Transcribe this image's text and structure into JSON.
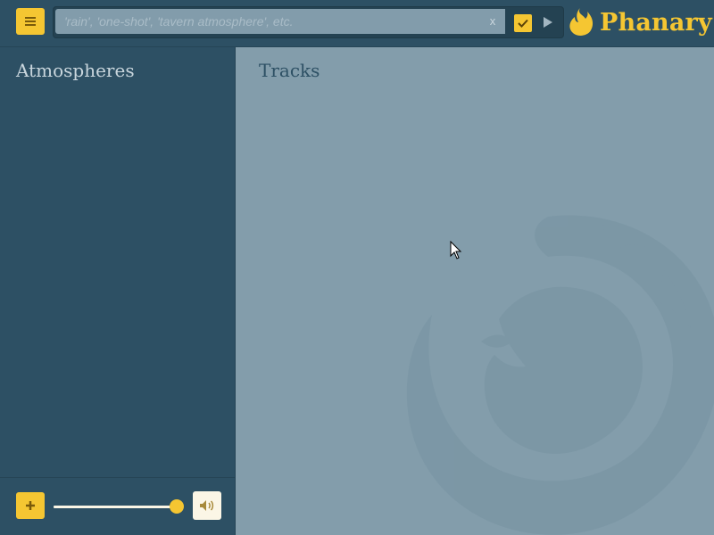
{
  "header": {
    "menu_icon": "hamburger-menu-icon",
    "search": {
      "placeholder": "'rain', 'one-shot', 'tavern atmosphere', etc.",
      "value": "",
      "clear_label": "x",
      "confirm_icon": "checkmark-icon",
      "play_icon": "play-icon"
    },
    "brand": {
      "name": "Phanary",
      "logo_icon": "flame-logo-icon"
    }
  },
  "sidebar": {
    "title": "Atmospheres",
    "items": [],
    "footer": {
      "add_icon": "plus-icon",
      "volume_level": 1.0,
      "volume_icon": "speaker-icon"
    }
  },
  "main": {
    "title": "Tracks",
    "items": [],
    "watermark_icon": "phoenix-watermark-icon"
  },
  "colors": {
    "accent": "#f5c632",
    "background": "#2d5064",
    "panel": "#839dab",
    "text_light": "#c9d6dd"
  }
}
